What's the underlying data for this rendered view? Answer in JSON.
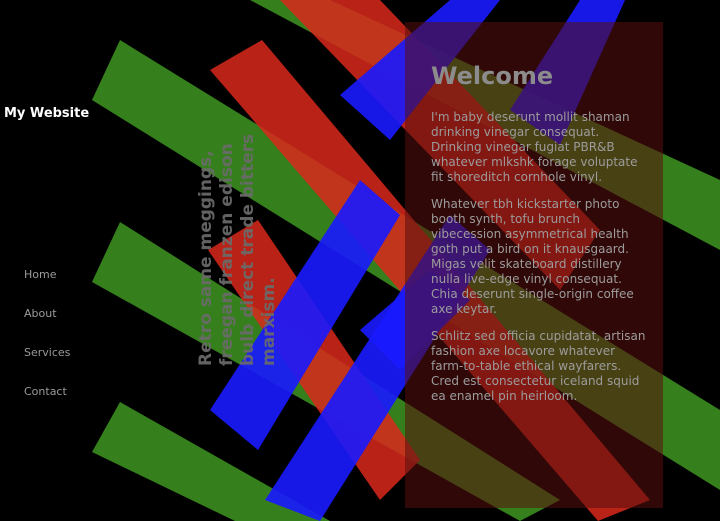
{
  "site": {
    "title": "My Website"
  },
  "nav": {
    "items": [
      {
        "label": "Home"
      },
      {
        "label": "About"
      },
      {
        "label": "Services"
      },
      {
        "label": "Contact"
      }
    ]
  },
  "tagline": "Retro same meggings, freegan franzen edison bulb direct trade bitters marxism.",
  "main": {
    "heading": "Welcome",
    "paragraphs": [
      "I'm baby deserunt mollit shaman drinking vinegar consequat. Drinking vinegar fugiat PBR&B whatever mlkshk forage voluptate fit shoreditch cornhole vinyl.",
      "Whatever tbh kickstarter photo booth synth, tofu brunch vibecession asymmetrical health goth put a bird on it knausgaard. Migas velit skateboard distillery nulla live-edge vinyl consequat. Chia deserunt single-origin coffee axe keytar.",
      "Schlitz sed officia cupidatat, artisan fashion axe locavore whatever farm-to-table ethical wayfarers. Cred est consectetur iceland squid ea enamel pin heirloom."
    ]
  },
  "colors": {
    "background": "#000000",
    "stripe_green": "#3a8a1e",
    "stripe_red": "#d8281b",
    "stripe_blue": "#1a1aff",
    "panel": "#580e0e",
    "nav_text": "#9a9a9a",
    "title_text": "#ffffff"
  }
}
